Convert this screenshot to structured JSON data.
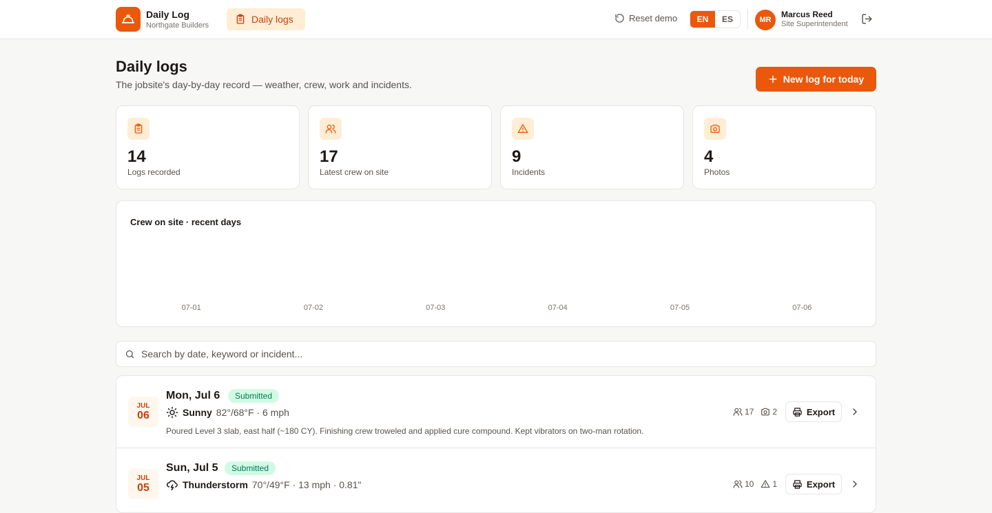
{
  "app": {
    "name": "Daily Log",
    "org": "Northgate Builders",
    "nav_tab": "Daily logs",
    "reset_label": "Reset demo",
    "languages": [
      "EN",
      "ES"
    ],
    "active_language": "EN",
    "user": {
      "initials": "MR",
      "name": "Marcus Reed",
      "role": "Site Superintendent"
    }
  },
  "page": {
    "title": "Daily logs",
    "subtitle": "The jobsite's day-by-day record — weather, crew, work and incidents.",
    "new_log_label": "New log for today"
  },
  "stats": [
    {
      "icon": "clipboard-icon",
      "value": "14",
      "label": "Logs recorded"
    },
    {
      "icon": "users-icon",
      "value": "17",
      "label": "Latest crew on site"
    },
    {
      "icon": "alert-triangle-icon",
      "value": "9",
      "label": "Incidents"
    },
    {
      "icon": "camera-icon",
      "value": "4",
      "label": "Photos"
    }
  ],
  "chart": {
    "title": "Crew on site · recent days"
  },
  "chart_data": {
    "type": "bar",
    "title": "Crew on site · recent days",
    "categories": [
      "07-01",
      "07-02",
      "07-03",
      "07-04",
      "07-05",
      "07-06"
    ]
  },
  "search": {
    "placeholder": "Search by date, keyword or incident..."
  },
  "logs": [
    {
      "month": "JUL",
      "day": "06",
      "weekday_label": "Mon, Jul 6",
      "status": "Submitted",
      "weather_icon": "sun-icon",
      "condition": "Sunny",
      "weather_meta": "82°/68°F · 6 mph",
      "summary": "Poured Level 3 slab, east half (~180 CY). Finishing crew troweled and applied cure compound. Kept vibrators on two-man rotation.",
      "crew": "17",
      "photos": "2",
      "export_label": "Export"
    },
    {
      "month": "JUL",
      "day": "05",
      "weekday_label": "Sun, Jul 5",
      "status": "Submitted",
      "weather_icon": "storm-icon",
      "condition": "Thunderstorm",
      "weather_meta": "70°/49°F · 13 mph · 0.81\"",
      "summary": "",
      "crew": "10",
      "incidents": "1",
      "export_label": "Export"
    }
  ],
  "colors": {
    "accent": "#ea580c",
    "accent_soft": "#ffedd5",
    "status_bg": "#d1fae5",
    "status_text": "#047857"
  }
}
